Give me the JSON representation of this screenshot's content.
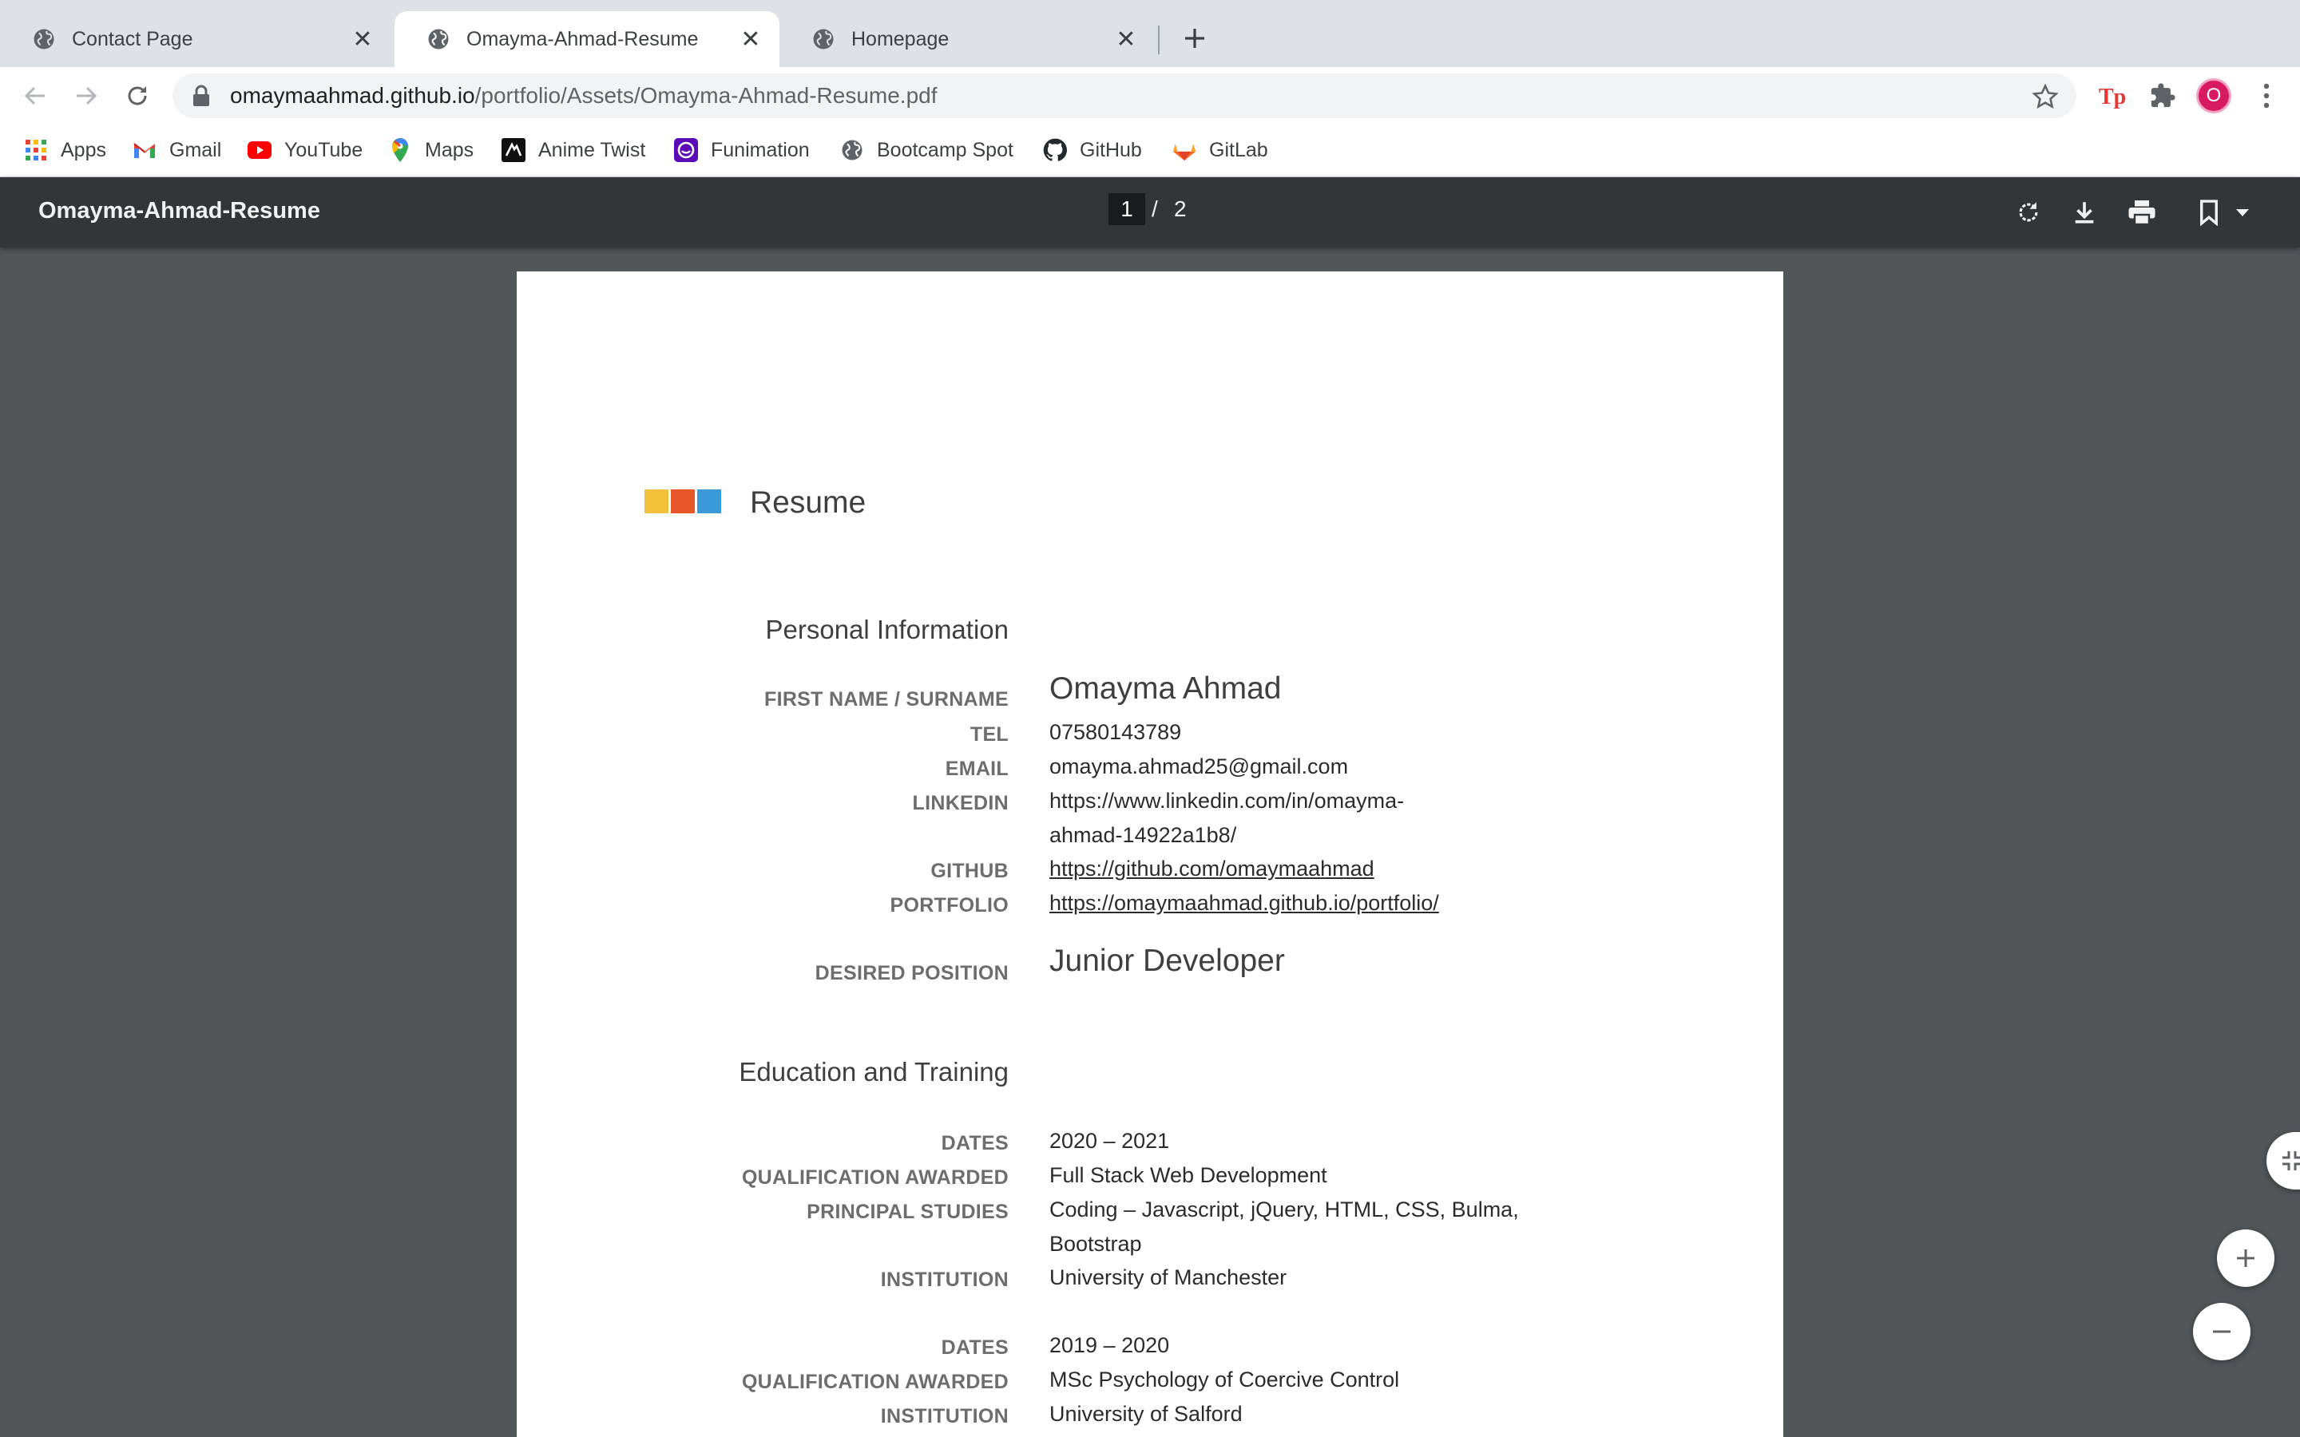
{
  "browser": {
    "tabs": [
      {
        "title": "Contact Page",
        "active": false
      },
      {
        "title": "Omayma-Ahmad-Resume",
        "active": true
      },
      {
        "title": "Homepage",
        "active": false
      }
    ],
    "url": {
      "host": "omaymaahmad.github.io",
      "path": "/portfolio/Assets/Omayma-Ahmad-Resume.pdf"
    },
    "profile_initial": "O",
    "bookmarks": [
      {
        "label": "Apps",
        "icon": "apps-grid-icon"
      },
      {
        "label": "Gmail",
        "icon": "gmail-icon"
      },
      {
        "label": "YouTube",
        "icon": "youtube-icon"
      },
      {
        "label": "Maps",
        "icon": "maps-pin-icon"
      },
      {
        "label": "Anime Twist",
        "icon": "anime-twist-icon"
      },
      {
        "label": "Funimation",
        "icon": "funimation-icon"
      },
      {
        "label": "Bootcamp Spot",
        "icon": "globe-icon"
      },
      {
        "label": "GitHub",
        "icon": "github-icon"
      },
      {
        "label": "GitLab",
        "icon": "gitlab-icon"
      }
    ]
  },
  "pdf_viewer": {
    "title": "Omayma-Ahmad-Resume",
    "current_page": "1",
    "separator": "/",
    "total_pages": "2"
  },
  "resume": {
    "title": "Resume",
    "logo_colors": [
      "#f3c03c",
      "#e8572a",
      "#3a9ad9"
    ],
    "personal": {
      "section_title": "Personal Information",
      "name_label": "FIRST NAME / SURNAME",
      "name": "Omayma Ahmad",
      "tel_label": "TEL",
      "tel": "07580143789",
      "email_label": "EMAIL",
      "email": "omayma.ahmad25@gmail.com",
      "linkedin_label": "LINKEDIN",
      "linkedin_line1": "https://www.linkedin.com/in/omayma-",
      "linkedin_line2": "ahmad-14922a1b8/",
      "github_label": "GITHUB",
      "github": "https://github.com/omaymaahmad",
      "portfolio_label": "PORTFOLIO",
      "portfolio": "https://omaymaahmad.github.io/portfolio/",
      "position_label": "DESIRED POSITION",
      "position": "Junior Developer"
    },
    "education": {
      "section_title": "Education and Training",
      "entries": [
        {
          "dates_label": "DATES",
          "dates": "2020 – 2021",
          "qualification_label": "QUALIFICATION AWARDED",
          "qualification": "Full Stack Web Development",
          "studies_label": "PRINCIPAL STUDIES",
          "studies_line1": "Coding – Javascript, jQuery, HTML, CSS, Bulma,",
          "studies_line2": "Bootstrap",
          "institution_label": "INSTITUTION",
          "institution": "University of Manchester"
        },
        {
          "dates_label": "DATES",
          "dates": "2019 – 2020",
          "qualification_label": "QUALIFICATION AWARDED",
          "qualification": "MSc Psychology of Coercive Control",
          "institution_label": "INSTITUTION",
          "institution": "University of Salford"
        }
      ]
    }
  }
}
